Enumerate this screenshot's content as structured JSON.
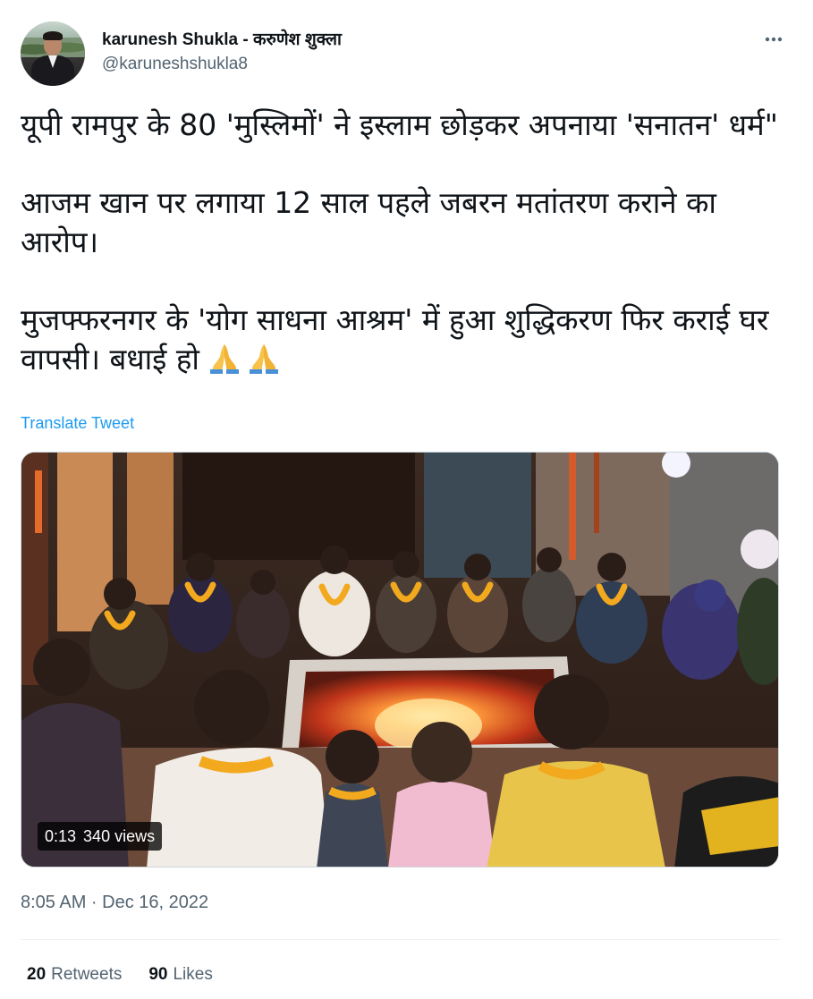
{
  "author": {
    "display_name": "karunesh Shukla - करुणेश शुक्ला",
    "handle": "@karuneshshukla8",
    "avatar_icon": "profile-photo"
  },
  "tweet": {
    "paragraphs": [
      "यूपी रामपुर के 80 'मुस्लिमों' ने इस्लाम छोड़कर अपनाया 'सनातन' धर्म\"",
      "आजम खान पर लगाया 12 साल पहले जबरन मतांतरण कराने का आरोप।",
      "मुजफ्फरनगर के 'योग साधना आश्रम' में हुआ शुद्धिकरण फिर कराई घर वापसी। बधाई हो"
    ],
    "emoji_icon": "folded-hands-icon",
    "translate_label": "Translate Tweet"
  },
  "media": {
    "duration": "0:13",
    "views": "340 views"
  },
  "timestamp": "8:05 AM · Dec 16, 2022",
  "stats": {
    "retweets_count": "20",
    "retweets_label": "Retweets",
    "likes_count": "90",
    "likes_label": "Likes"
  },
  "colors": {
    "link_blue": "#1d9bf0",
    "secondary_text": "#536471",
    "primary_text": "#0f1419"
  }
}
